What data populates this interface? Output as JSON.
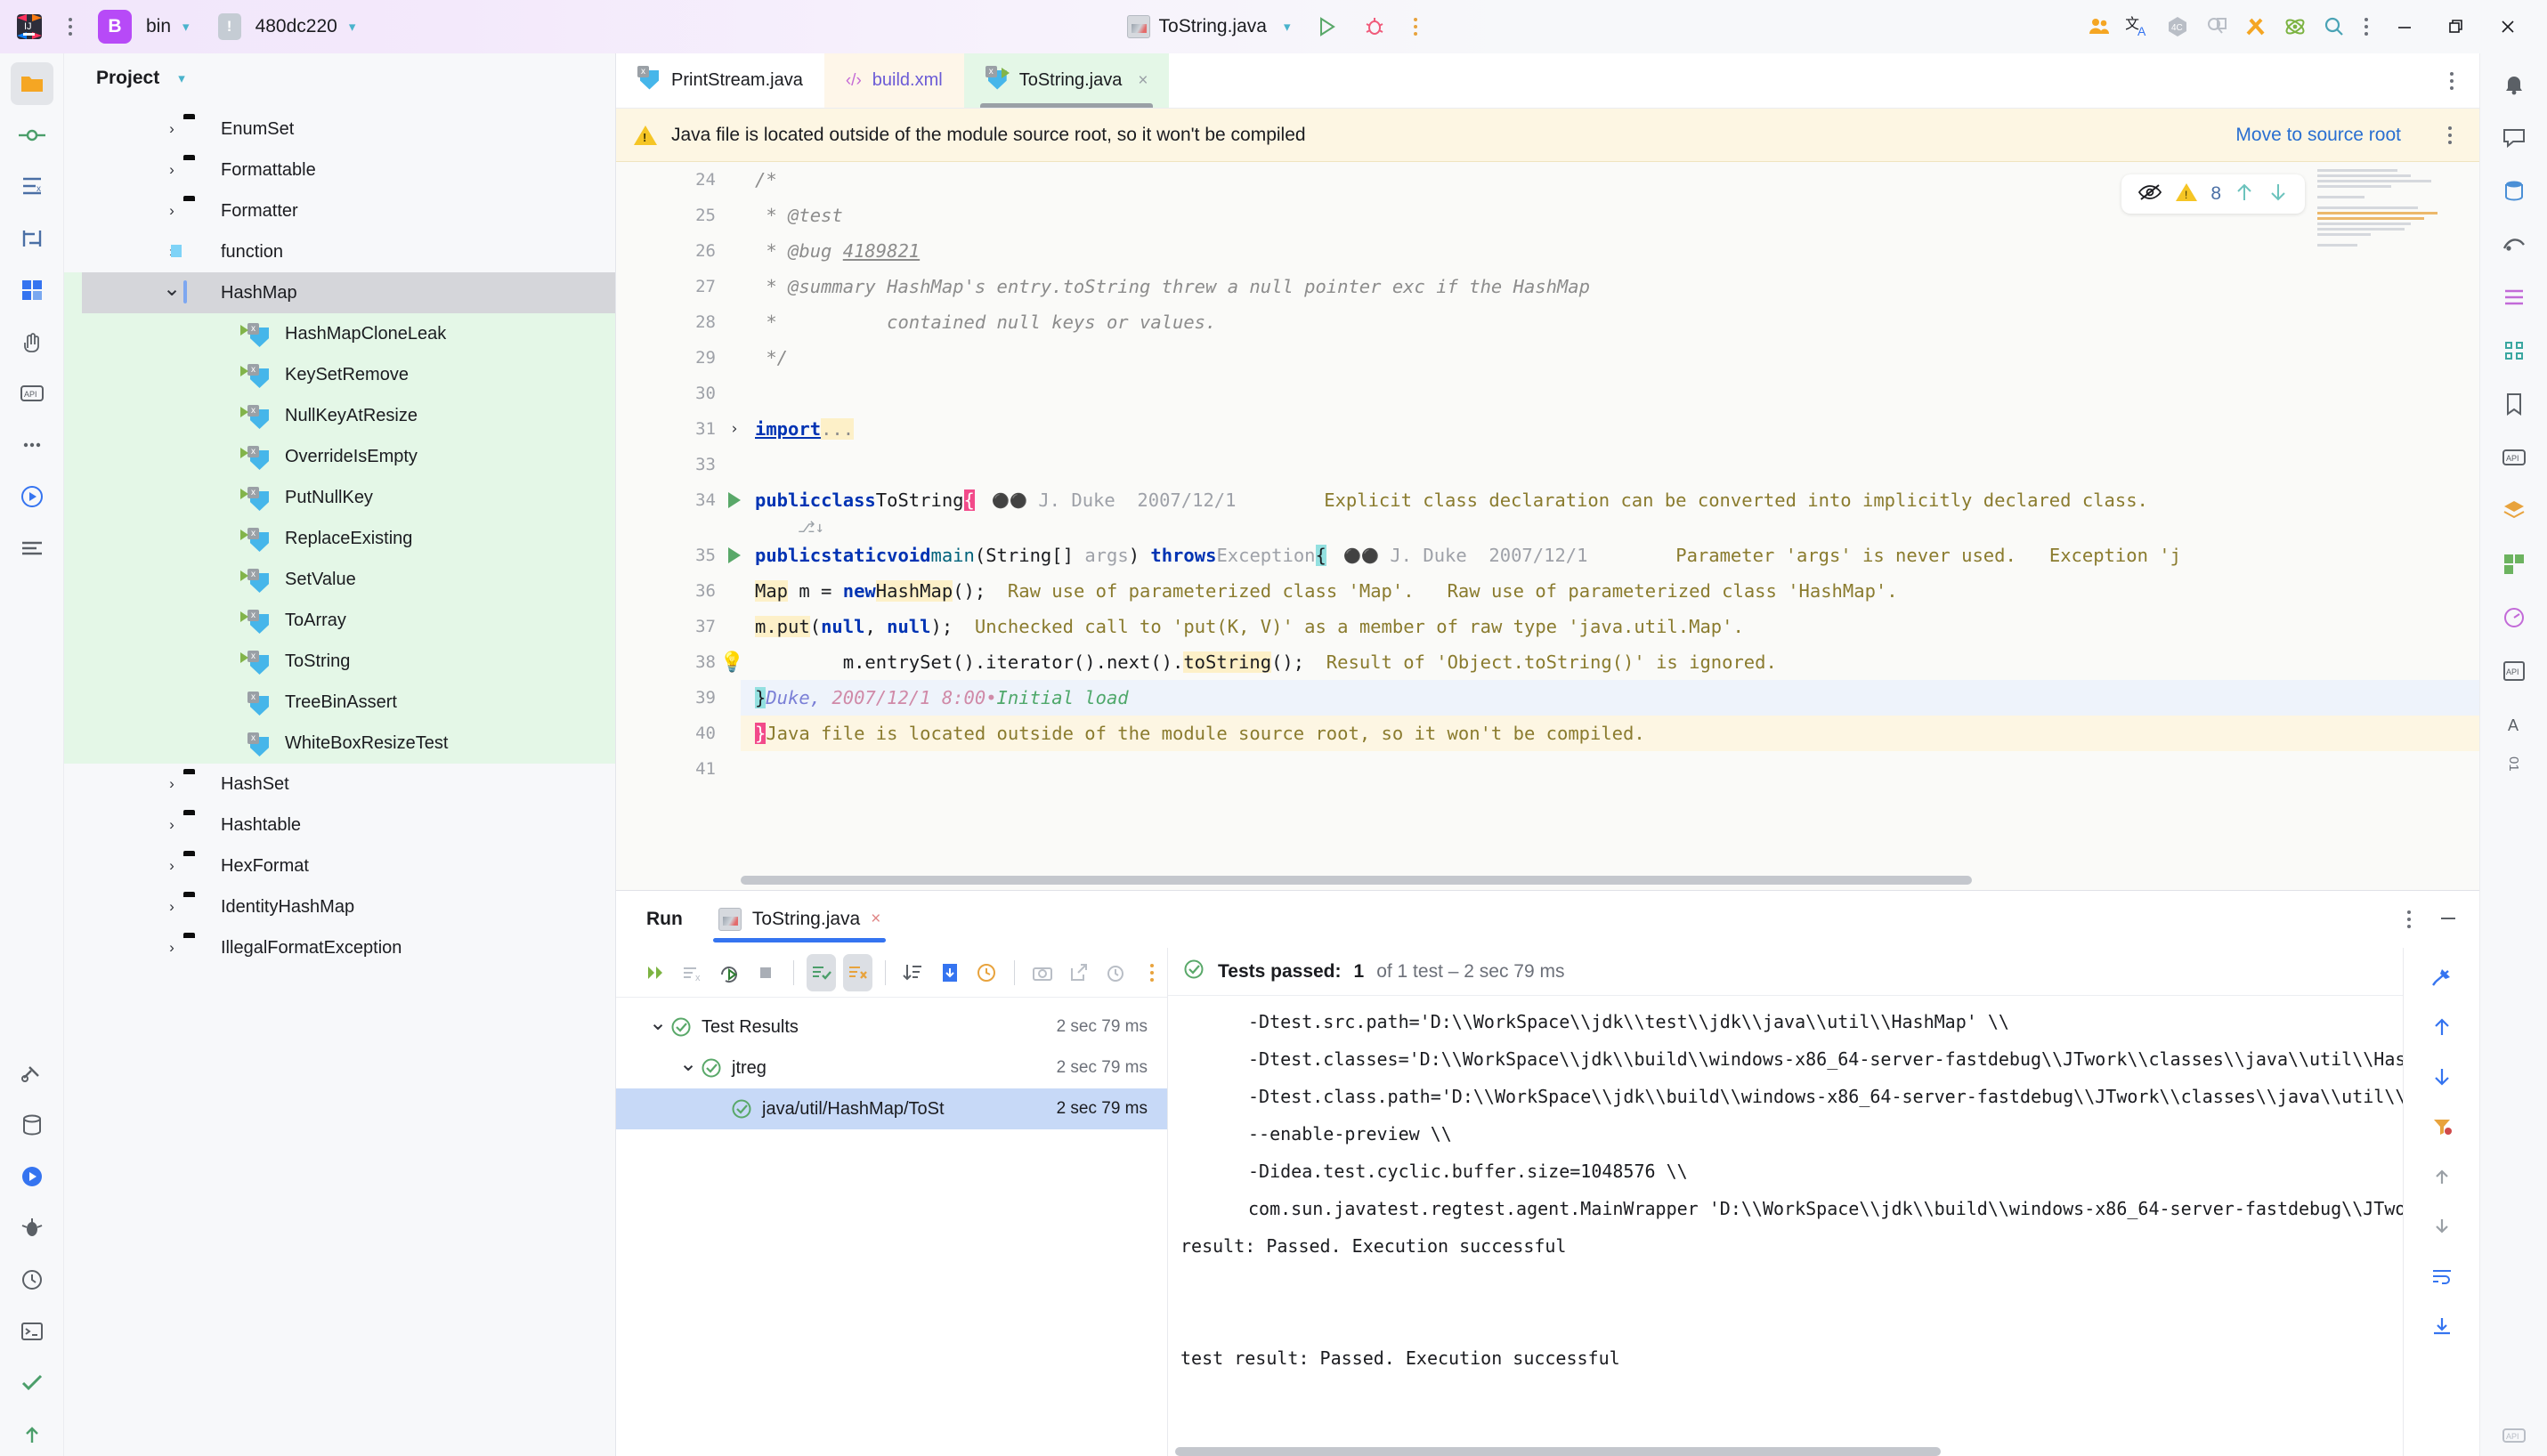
{
  "titlebar": {
    "menu_icon": "hamburger-dots-icon",
    "project_badge": "B",
    "project_name": "bin",
    "branch_icon": "module-icon",
    "branch_name": "480dc220",
    "run_config": "ToString.java",
    "run_icon": "run-play-icon",
    "debug_icon": "debug-bug-icon",
    "more_icon": "more-vertical-icon",
    "right_icons": [
      "collaborate-icon",
      "translate-icon",
      "ai-assistant-icon",
      "search-everywhere-doc-icon",
      "tools-icon",
      "science-atom-icon",
      "search-icon",
      "more-vertical-icon"
    ],
    "window_minimize": "minimize-icon",
    "window_restore": "restore-icon",
    "window_close": "close-icon"
  },
  "activitybar": {
    "items": [
      "project-folder-icon",
      "commit-icon",
      "structure-icon",
      "bookmarks-icon",
      "pull-requests-icon",
      "plugins-icon",
      "hand-icon",
      "api-icon",
      "more-dots-icon",
      "run-circle-icon",
      "terminal-lines-icon",
      "build-icon",
      "database-icon",
      "debug-run-icon",
      "profiler-bug-icon",
      "time-icon",
      "terminal-icon",
      "todo-icon",
      "commit-arrow-icon"
    ]
  },
  "project_panel": {
    "title": "Project",
    "chevron": "chevron-down-icon",
    "tree": [
      {
        "label": "EnumSet",
        "icon": "folder-black",
        "chevron": "collapsed",
        "indent": 3,
        "green": false
      },
      {
        "label": "Formattable",
        "icon": "folder-black",
        "chevron": "collapsed",
        "indent": 3,
        "green": false
      },
      {
        "label": "Formatter",
        "icon": "folder-black",
        "chevron": "collapsed",
        "indent": 3,
        "green": false
      },
      {
        "label": "function",
        "icon": "folder-blue",
        "chevron": "collapsed",
        "indent": 3,
        "green": false
      },
      {
        "label": "HashMap",
        "icon": "folder-open",
        "chevron": "expanded",
        "indent": 3,
        "green": true,
        "selected": true
      },
      {
        "label": "HashMapCloneLeak",
        "icon": "java-run",
        "chevron": "",
        "indent": 5,
        "green": true
      },
      {
        "label": "KeySetRemove",
        "icon": "java-run",
        "chevron": "",
        "indent": 5,
        "green": true
      },
      {
        "label": "NullKeyAtResize",
        "icon": "java-run",
        "chevron": "",
        "indent": 5,
        "green": true
      },
      {
        "label": "OverrideIsEmpty",
        "icon": "java-run",
        "chevron": "",
        "indent": 5,
        "green": true
      },
      {
        "label": "PutNullKey",
        "icon": "java-run",
        "chevron": "",
        "indent": 5,
        "green": true
      },
      {
        "label": "ReplaceExisting",
        "icon": "java-run",
        "chevron": "",
        "indent": 5,
        "green": true
      },
      {
        "label": "SetValue",
        "icon": "java-run",
        "chevron": "",
        "indent": 5,
        "green": true
      },
      {
        "label": "ToArray",
        "icon": "java-run",
        "chevron": "",
        "indent": 5,
        "green": true
      },
      {
        "label": "ToString",
        "icon": "java-run",
        "chevron": "",
        "indent": 5,
        "green": true
      },
      {
        "label": "TreeBinAssert",
        "icon": "java",
        "chevron": "",
        "indent": 5,
        "green": true
      },
      {
        "label": "WhiteBoxResizeTest",
        "icon": "java",
        "chevron": "",
        "indent": 5,
        "green": true
      },
      {
        "label": "HashSet",
        "icon": "folder-black",
        "chevron": "collapsed",
        "indent": 3,
        "green": false
      },
      {
        "label": "Hashtable",
        "icon": "folder-black",
        "chevron": "collapsed",
        "indent": 3,
        "green": false
      },
      {
        "label": "HexFormat",
        "icon": "folder-black",
        "chevron": "collapsed",
        "indent": 3,
        "green": false
      },
      {
        "label": "IdentityHashMap",
        "icon": "folder-black",
        "chevron": "collapsed",
        "indent": 3,
        "green": false
      },
      {
        "label": "IllegalFormatException",
        "icon": "folder-black",
        "chevron": "collapsed",
        "indent": 3,
        "green": false
      }
    ]
  },
  "editor": {
    "tabs": [
      {
        "label": "PrintStream.java",
        "icon": "java-file-icon",
        "style": "plain",
        "closable": false
      },
      {
        "label": "build.xml",
        "icon": "xml-file-icon",
        "style": "xml",
        "closable": false
      },
      {
        "label": "ToString.java",
        "icon": "java-run-file-icon",
        "style": "active",
        "closable": true,
        "close": "×"
      }
    ],
    "tabbar_more": "more-vertical-icon",
    "warning": {
      "icon": "warning-triangle-icon",
      "text": "Java file is located outside of the module source root, so it won't be compiled",
      "action": "Move to source root",
      "more": "more-vertical-icon"
    },
    "inspection_widget": {
      "eye_icon": "eye-off-icon",
      "warning_icon": "warning-triangle-icon",
      "warning_count": "8",
      "prev_icon": "arrow-up-icon",
      "next_icon": "arrow-down-icon"
    },
    "lines": [
      {
        "num": "24",
        "code": "/*",
        "kind": "comment"
      },
      {
        "num": "25",
        "code": " * @test",
        "kind": "comment"
      },
      {
        "num": "26",
        "code": " * @bug 4189821",
        "kind": "comment-bug",
        "bug_id": "4189821"
      },
      {
        "num": "27",
        "code": " * @summary HashMap's entry.toString threw a null pointer exc if the HashMap",
        "kind": "comment"
      },
      {
        "num": "28",
        "code": " *          contained null keys or values.",
        "kind": "comment"
      },
      {
        "num": "29",
        "code": " */",
        "kind": "comment"
      },
      {
        "num": "30",
        "code": "",
        "kind": "blank"
      },
      {
        "num": "31",
        "code": "import ...",
        "kind": "fold-import"
      },
      {
        "num": "33",
        "code": "",
        "kind": "blank"
      },
      {
        "num": "34",
        "code": "public class ToString {",
        "kind": "class-decl",
        "vcs_author": "J. Duke",
        "vcs_date": "2007/12/1",
        "hint": "Explicit class declaration can be converted into implicitly declared class."
      },
      {
        "num": "35",
        "code": "public static void main(String[] args) throws Exception {",
        "kind": "method-decl",
        "vcs_author": "J. Duke",
        "vcs_date": "2007/12/1",
        "hint": "Parameter 'args' is never used.   Exception 'j"
      },
      {
        "num": "36",
        "code": "Map m = new HashMap();",
        "kind": "stmt",
        "hint": "Raw use of parameterized class 'Map'.   Raw use of parameterized class 'HashMap'."
      },
      {
        "num": "37",
        "code": "m.put(null, null);",
        "kind": "stmt",
        "hint": "Unchecked call to 'put(K, V)' as a member of raw type 'java.util.Map'."
      },
      {
        "num": "38",
        "code": "m.entrySet().iterator().next().toString();",
        "kind": "stmt",
        "hint": "Result of 'Object.toString()' is ignored."
      },
      {
        "num": "39",
        "code": "}",
        "kind": "close-annot",
        "vcs_author": "Duke,",
        "vcs_date": "2007/12/1 8:00",
        "vcs_sep": "•",
        "vcs_msg": "Initial load"
      },
      {
        "num": "40",
        "code": "}",
        "kind": "close-warn",
        "hint": "Java file is located outside of the module source root, so it won't be compiled."
      },
      {
        "num": "41",
        "code": "",
        "kind": "blank"
      }
    ]
  },
  "run_panel": {
    "title": "Run",
    "tab": {
      "label": "ToString.java",
      "icon": "java-run-file-icon",
      "close": "×"
    },
    "header_more": "more-vertical-icon",
    "header_minimize": "minimize-icon",
    "toolbar": [
      {
        "icon": "rerun-icon",
        "active": false
      },
      {
        "icon": "dismiss-icon",
        "active": false
      },
      {
        "icon": "rerun-failed-icon",
        "active": false
      },
      {
        "icon": "stop-icon",
        "active": false
      },
      {
        "icon": "show-passed-icon",
        "active": true
      },
      {
        "icon": "show-ignored-icon",
        "active": true
      },
      {
        "icon": "sort-icon",
        "active": false
      },
      {
        "icon": "export-icon",
        "active": false
      },
      {
        "icon": "history-icon",
        "active": false
      },
      {
        "icon": "screenshot-icon",
        "active": false
      },
      {
        "icon": "open-external-icon",
        "active": false
      },
      {
        "icon": "clock-icon",
        "active": false
      },
      {
        "icon": "more-vertical-icon",
        "active": false
      }
    ],
    "test_tree": [
      {
        "label": "Test Results",
        "time": "2 sec 79 ms",
        "indent": 1,
        "chevron": "expanded",
        "status": "passed",
        "selected": false
      },
      {
        "label": "jtreg",
        "time": "2 sec 79 ms",
        "indent": 2,
        "chevron": "expanded",
        "status": "passed",
        "selected": false
      },
      {
        "label": "java/util/HashMap/ToSt",
        "time": "2 sec 79 ms",
        "indent": 3,
        "chevron": "",
        "status": "passed",
        "selected": true
      }
    ],
    "status": {
      "icon": "check-circle-icon",
      "prefix": "Tests passed:",
      "count": "1",
      "suffix": "of 1 test – 2 sec 79 ms"
    },
    "console": [
      {
        "text": "-Dtest.src.path='D:\\\\WorkSpace\\\\jdk\\\\test\\\\jdk\\\\java\\\\util\\\\HashMap' \\\\",
        "indent": true,
        "clipped": true
      },
      {
        "text": "-Dtest.classes='D:\\\\WorkSpace\\\\jdk\\\\build\\\\windows-x86_64-server-fastdebug\\\\JTwork\\\\classes\\\\java\\\\util\\\\HashMap\\\\ToString.d' \\\\",
        "indent": true
      },
      {
        "text": "-Dtest.class.path='D:\\\\WorkSpace\\\\jdk\\\\build\\\\windows-x86_64-server-fastdebug\\\\JTwork\\\\classes\\\\java\\\\util\\\\HashMap\\\\ToString.d' \\\\",
        "indent": true
      },
      {
        "text": "--enable-preview \\\\",
        "indent": true
      },
      {
        "text": "-Didea.test.cyclic.buffer.size=1048576 \\\\",
        "indent": true
      },
      {
        "text": "com.sun.javatest.regtest.agent.MainWrapper 'D:\\\\WorkSpace\\\\jdk\\\\build\\\\windows-x86_64-server-fastdebug\\\\JTwork\\\\java\\\\util\\\\HashMap\\\\ToString.",
        "indent": true
      },
      {
        "text": "result: Passed. Execution successful",
        "indent": false
      },
      {
        "text": "",
        "indent": false
      },
      {
        "text": "",
        "indent": false
      },
      {
        "text": "test result: Passed. Execution successful",
        "indent": false
      }
    ],
    "sidebar_icons": [
      "pin-icon",
      "arrow-up-icon",
      "arrow-down-icon",
      "filter-icon",
      "scroll-up-icon",
      "scroll-down-icon",
      "wrap-text-icon",
      "save-icon"
    ]
  },
  "rightbar": {
    "items": [
      "notifications-bell-icon",
      "ai-chat-icon",
      "database-icon",
      "gradle-icon",
      "maven-icon",
      "structure-icon",
      "bookmarks-icon",
      "api-icon",
      "layers-icon",
      "plugins-icon",
      "profiler-icon",
      "api-doc-icon",
      "text-icon"
    ],
    "vertical_text": "01"
  },
  "colors": {
    "accent_purple": "#b74af7",
    "tab_active_green": "#e4f7e7",
    "warning_yellow": "#fdf6e3",
    "link_blue": "#2a6fd1",
    "selection_blue": "#c7d9f7",
    "pass_green": "#59a869",
    "hint_olive": "#8a7b2e"
  }
}
